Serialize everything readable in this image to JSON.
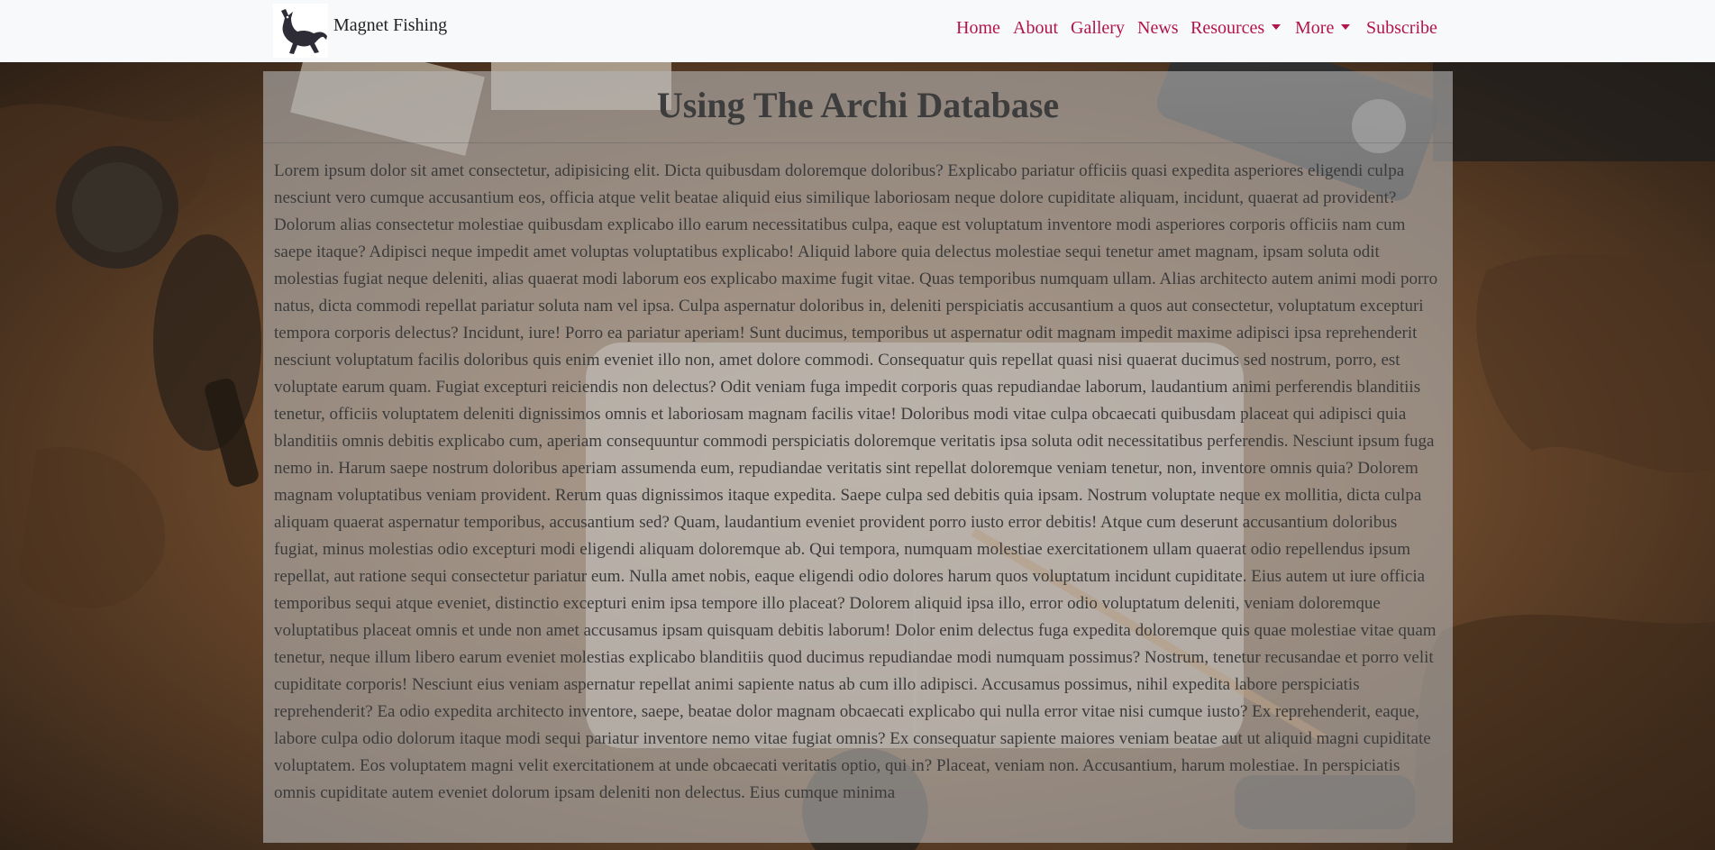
{
  "brand": {
    "name": "Magnet Fishing",
    "logo_icon": "cat-logo-icon"
  },
  "nav": {
    "home": "Home",
    "about": "About",
    "gallery": "Gallery",
    "news": "News",
    "resources": "Resources",
    "more": "More",
    "subscribe": "Subscribe"
  },
  "colors": {
    "nav_link": "#b01649",
    "navbar_bg": "#f8f9fa"
  },
  "page": {
    "title": "Using The Archi Database",
    "body": "Lorem ipsum dolor sit amet consectetur, adipisicing elit. Dicta quibusdam doloremque doloribus? Explicabo pariatur officiis quasi expedita asperiores eligendi culpa nesciunt vero cumque accusantium eos, officia atque velit beatae aliquid eius similique laboriosam neque dolore cupiditate aliquam, incidunt, quaerat ad provident? Dolorum alias consectetur molestiae quibusdam explicabo illo earum necessitatibus culpa, eaque est voluptatum inventore modi asperiores corporis officiis nam cum saepe itaque? Adipisci neque impedit amet voluptas voluptatibus explicabo! Aliquid labore quia delectus molestiae sequi tenetur amet magnam, ipsam soluta odit molestias fugiat neque deleniti, alias quaerat modi laborum eos explicabo maxime fugit vitae. Quas temporibus numquam ullam. Alias architecto autem animi modi porro natus, dicta commodi repellat pariatur soluta nam vel ipsa. Culpa aspernatur doloribus in, deleniti perspiciatis accusantium a quos aut consectetur, voluptatum excepturi tempora corporis delectus? Incidunt, iure! Porro ea pariatur aperiam! Sunt ducimus, temporibus ut aspernatur odit magnam impedit maxime adipisci ipsa reprehenderit nesciunt voluptatum facilis doloribus quis enim eveniet illo non, amet dolore commodi. Consequatur quis repellat quasi nisi quaerat ducimus sed nostrum, porro, est voluptate earum quam. Fugiat excepturi reiciendis non delectus? Odit veniam fuga impedit corporis quas repudiandae laborum, laudantium animi perferendis blanditiis tenetur, officiis voluptatem deleniti dignissimos omnis et laboriosam magnam facilis vitae! Doloribus modi vitae culpa obcaecati quibusdam placeat qui adipisci quia blanditiis omnis debitis explicabo cum, aperiam consequuntur commodi perspiciatis doloremque veritatis ipsa soluta odit necessitatibus perferendis. Nesciunt ipsum fuga nemo in. Harum saepe nostrum doloribus aperiam assumenda eum, repudiandae veritatis sint repellat doloremque veniam tenetur, non, inventore omnis quia? Dolorem magnam voluptatibus veniam provident. Rerum quas dignissimos itaque expedita. Saepe culpa sed debitis quia ipsam. Nostrum voluptate neque ex mollitia, dicta culpa aliquam quaerat aspernatur temporibus, accusantium sed? Quam, laudantium eveniet provident porro iusto error debitis! Atque cum deserunt accusantium doloribus fugiat, minus molestias odio excepturi modi eligendi aliquam doloremque ab. Qui tempora, numquam molestiae exercitationem ullam quaerat odio repellendus ipsum repellat, aut ratione sequi consectetur pariatur eum. Nulla amet nobis, eaque eligendi odio dolores harum quos voluptatum incidunt cupiditate. Eius autem ut iure officia temporibus sequi atque eveniet, distinctio excepturi enim ipsa tempore illo placeat? Dolorem aliquid ipsa illo, error odio voluptatum deleniti, veniam doloremque voluptatibus placeat omnis et unde non amet accusamus ipsam quisquam debitis laborum! Dolor enim delectus fuga expedita doloremque quis quae molestiae vitae quam tenetur, neque illum libero earum eveniet molestias explicabo blanditiis quod ducimus repudiandae modi numquam possimus? Nostrum, tenetur recusandae et porro velit cupiditate corporis! Nesciunt eius veniam aspernatur repellat animi sapiente natus ab cum illo adipisci. Accusamus possimus, nihil expedita labore perspiciatis reprehenderit? Ea odio expedita architecto inventore, saepe, beatae dolor magnam obcaecati explicabo qui nulla error vitae nisi cumque iusto? Ex reprehenderit, eaque, labore culpa odio dolorum itaque modi sequi pariatur inventore nemo vitae fugiat omnis? Ex consequatur sapiente maiores veniam beatae aut ut aliquid magni cupiditate voluptatem. Eos voluptatem magni velit exercitationem at unde obcaecati veritatis optio, qui in? Placeat, veniam non. Accusantium, harum molestiae. In perspiciatis omnis cupiditate autem eveniet dolorum ipsam deleniti non delectus. Eius cumque minima"
  }
}
